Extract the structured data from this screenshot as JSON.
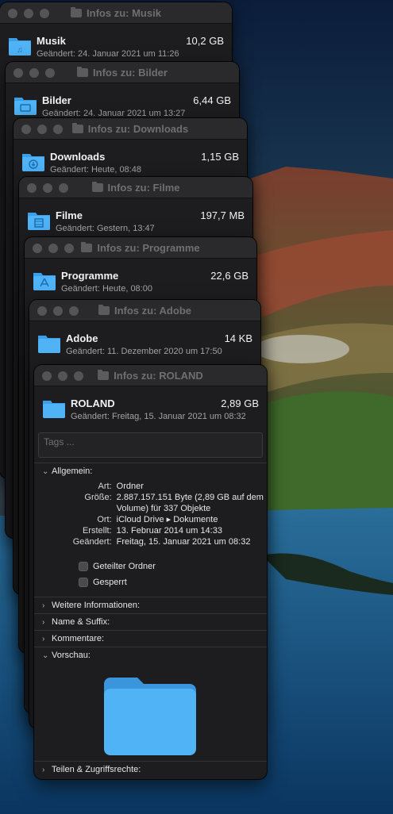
{
  "windows": [
    {
      "title": "Infos zu: Musik",
      "name": "Musik",
      "size": "10,2 GB",
      "modified": "Geändert: 24. Januar 2021 um 11:26",
      "icon": "music-folder-icon"
    },
    {
      "title": "Infos zu: Bilder",
      "name": "Bilder",
      "size": "6,44 GB",
      "modified": "Geändert: 24. Januar 2021 um 13:27",
      "icon": "pictures-folder-icon"
    },
    {
      "title": "Infos zu: Downloads",
      "name": "Downloads",
      "size": "1,15 GB",
      "modified": "Geändert: Heute, 08:48",
      "icon": "downloads-folder-icon"
    },
    {
      "title": "Infos zu: Filme",
      "name": "Filme",
      "size": "197,7 MB",
      "modified": "Geändert: Gestern, 13:47",
      "icon": "movies-folder-icon"
    },
    {
      "title": "Infos zu: Programme",
      "name": "Programme",
      "size": "22,6 GB",
      "modified": "Geändert: Heute, 08:00",
      "icon": "applications-folder-icon"
    },
    {
      "title": "Infos zu: Adobe",
      "name": "Adobe",
      "size": "14 KB",
      "modified": "Geändert: 11. Dezember 2020 um 17:50",
      "icon": "folder-icon"
    }
  ],
  "roland": {
    "title": "Infos zu: ROLAND",
    "name": "ROLAND",
    "size": "2,89 GB",
    "modified": "Geändert: Freitag, 15. Januar 2021 um 08:32",
    "tags_placeholder": "Tags ...",
    "general_label": "Allgemein:",
    "art_label": "Art:",
    "art_value": "Ordner",
    "groesse_label": "Größe:",
    "groesse_value1": "2.887.157.151 Byte (2,89 GB auf dem",
    "groesse_value2": "Volume) für 337 Objekte",
    "ort_label": "Ort:",
    "ort_value": "iCloud Drive ▸ Dokumente",
    "erstellt_label": "Erstellt:",
    "erstellt_value": "13. Februar 2014 um 14:33",
    "geaendert_label": "Geändert:",
    "geaendert_value": "Freitag, 15. Januar 2021 um 08:32",
    "shared_folder_label": "Geteilter Ordner",
    "locked_label": "Gesperrt",
    "more_info": "Weitere Informationen:",
    "name_ext": "Name & Suffix:",
    "comments": "Kommentare:",
    "preview": "Vorschau:",
    "sharing": "Teilen & Zugriffsrechte:"
  }
}
